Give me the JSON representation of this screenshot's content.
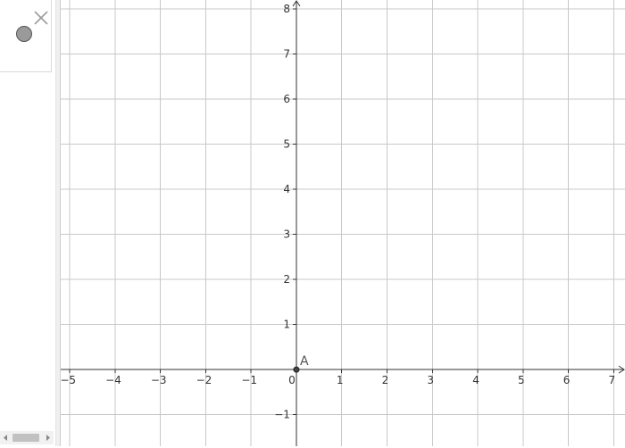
{
  "algebra_view": {
    "objects": [
      {
        "name": "A",
        "visible": true,
        "toggle_color": "#9a9a9a"
      }
    ]
  },
  "graphics_view": {
    "x_range": [
      -5.2,
      7.25
    ],
    "y_range": [
      -1.7,
      8.2
    ],
    "x_tick_step": 1,
    "y_tick_step": 1,
    "grid": true,
    "x_ticks": [
      "−5",
      "−4",
      "−3",
      "−2",
      "−1",
      "0",
      "1",
      "2",
      "3",
      "4",
      "5",
      "6",
      "7"
    ],
    "y_ticks": [
      "−1",
      "1",
      "2",
      "3",
      "4",
      "5",
      "6",
      "7",
      "8"
    ],
    "points": [
      {
        "label": "A",
        "x": 0,
        "y": 0
      }
    ]
  },
  "colors": {
    "grid": "#c8c8c8",
    "axis": "#333333",
    "point_fill": "#444444",
    "point_label": "#555555",
    "panel_border": "#d8d8d8"
  },
  "icons": [
    "close-icon",
    "visibility-toggle",
    "scroll-left-arrow-icon",
    "scroll-right-arrow-icon"
  ]
}
